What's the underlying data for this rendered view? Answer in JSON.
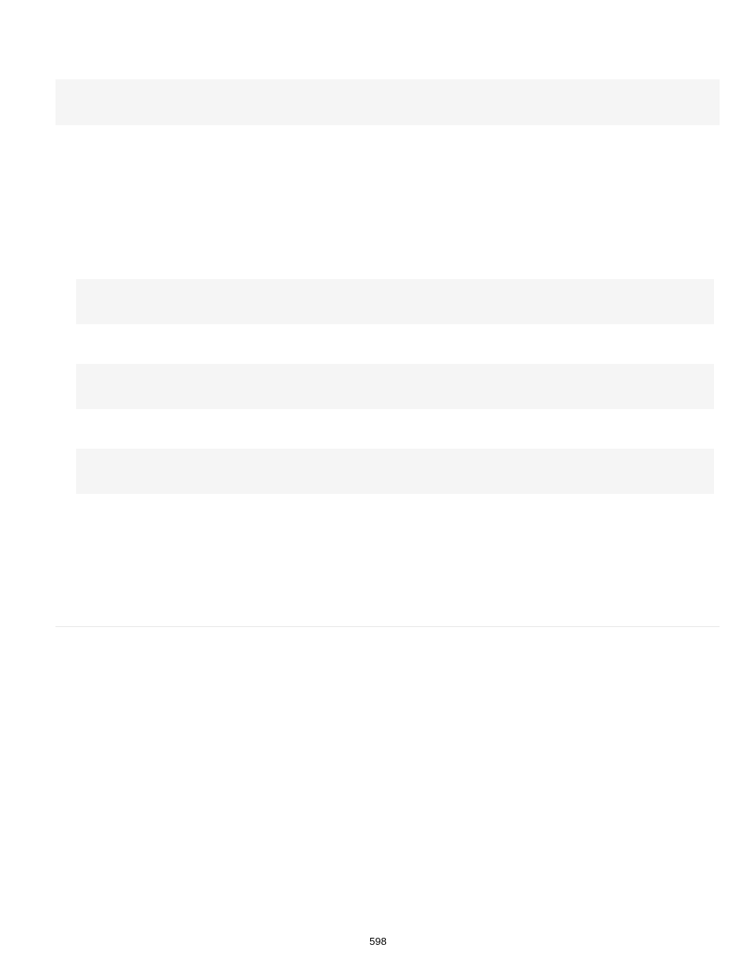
{
  "page_number": "598"
}
